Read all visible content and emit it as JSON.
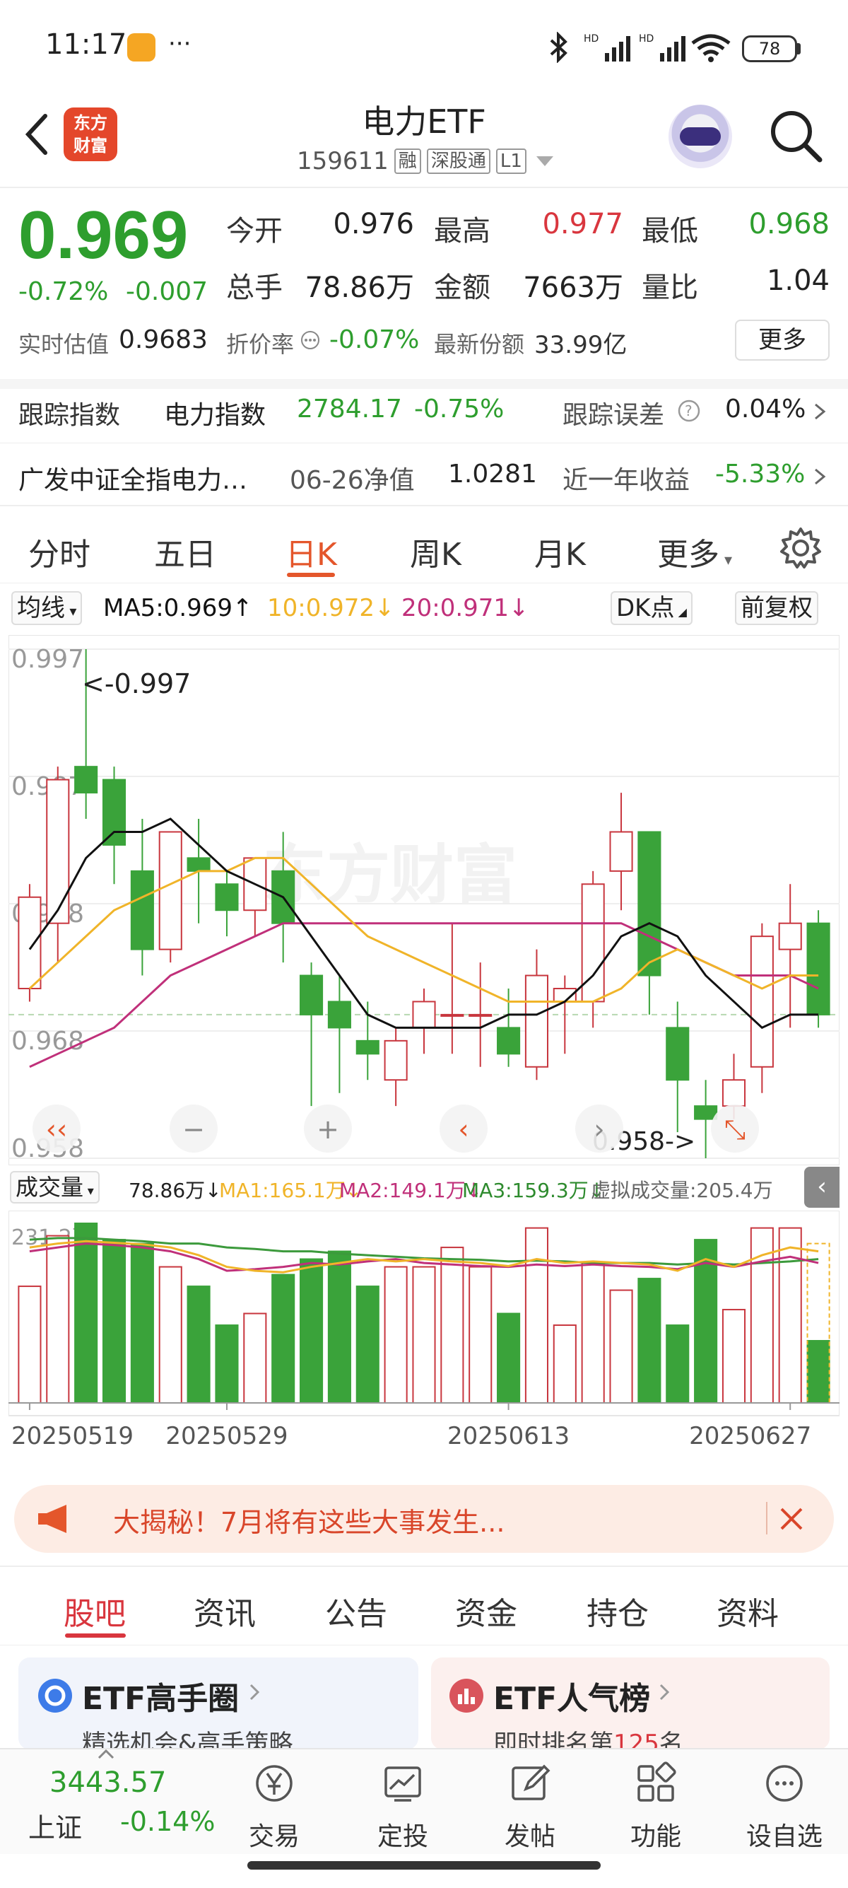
{
  "status_bar": {
    "time": "11:17",
    "dots": "···",
    "battery": "78"
  },
  "header": {
    "title": "电力ETF",
    "code": "159611",
    "tags": [
      "融",
      "深股通",
      "L1"
    ],
    "logo_text": "东方财富"
  },
  "quote": {
    "price": "0.969",
    "change_pct": "-0.72%",
    "change": "-0.007",
    "open_label": "今开",
    "open": "0.976",
    "high_label": "最高",
    "high": "0.977",
    "low_label": "最低",
    "low": "0.968",
    "volume_label": "总手",
    "volume": "78.86万",
    "amount_label": "金额",
    "amount": "7663万",
    "ratio_label": "量比",
    "ratio": "1.04",
    "est_label": "实时估值",
    "est": "0.9683",
    "discount_label": "折价率",
    "discount": "-0.07%",
    "shares_label": "最新份额",
    "shares": "33.99亿",
    "more": "更多"
  },
  "tracking": {
    "label": "跟踪指数",
    "index_name": "电力指数",
    "index_value": "2784.17",
    "index_change": "-0.75%",
    "error_label": "跟踪误差",
    "error_value": "0.04%"
  },
  "fund": {
    "name": "广发中证全指电力…",
    "nav_label": "06-26净值",
    "nav": "1.0281",
    "return_label": "近一年收益",
    "return_value": "-5.33%"
  },
  "kline_tabs": [
    "分时",
    "五日",
    "日K",
    "周K",
    "月K",
    "更多"
  ],
  "chart_toolbar": {
    "ma_select": "均线",
    "ma5": "MA5:0.969↑",
    "ma10": "10:0.972↓",
    "ma20": "20:0.971↓",
    "dk": "DK点",
    "adjust": "前复权",
    "vol_select": "成交量",
    "vol_value": "78.86万↓",
    "vma1": "MA1:165.1万↓",
    "vma2": "MA2:149.1万↓",
    "vma3": "MA3:159.3万↓",
    "virtual_vol": "虚拟成交量:205.4万"
  },
  "chart_data": {
    "type": "candlestick",
    "price_ticks": [
      "0.997",
      "0.987",
      "0.978",
      "0.968",
      "0.958"
    ],
    "ylim": [
      0.958,
      0.997
    ],
    "annotations": {
      "high": "<-0.997",
      "low": "0.958->"
    },
    "watermark": "东方财富",
    "volume_ticks": [
      "231.2万"
    ],
    "x_labels": [
      "20250519",
      "20250529",
      "20250613",
      "20250627"
    ],
    "candles": [
      {
        "o": 0.971,
        "c": 0.978,
        "h": 0.979,
        "l": 0.97,
        "v": 150
      },
      {
        "o": 0.976,
        "c": 0.987,
        "h": 0.988,
        "l": 0.973,
        "v": 215
      },
      {
        "o": 0.988,
        "c": 0.986,
        "h": 0.997,
        "l": 0.984,
        "v": 231
      },
      {
        "o": 0.987,
        "c": 0.982,
        "h": 0.988,
        "l": 0.979,
        "v": 210
      },
      {
        "o": 0.98,
        "c": 0.974,
        "h": 0.984,
        "l": 0.972,
        "v": 205
      },
      {
        "o": 0.974,
        "c": 0.983,
        "h": 0.983,
        "l": 0.973,
        "v": 175
      },
      {
        "o": 0.981,
        "c": 0.98,
        "h": 0.984,
        "l": 0.976,
        "v": 150
      },
      {
        "o": 0.979,
        "c": 0.977,
        "h": 0.98,
        "l": 0.975,
        "v": 100
      },
      {
        "o": 0.977,
        "c": 0.981,
        "h": 0.981,
        "l": 0.975,
        "v": 115
      },
      {
        "o": 0.98,
        "c": 0.976,
        "h": 0.983,
        "l": 0.973,
        "v": 165
      },
      {
        "o": 0.972,
        "c": 0.969,
        "h": 0.973,
        "l": 0.962,
        "v": 185
      },
      {
        "o": 0.97,
        "c": 0.968,
        "h": 0.972,
        "l": 0.963,
        "v": 195
      },
      {
        "o": 0.967,
        "c": 0.966,
        "h": 0.97,
        "l": 0.964,
        "v": 150
      },
      {
        "o": 0.964,
        "c": 0.967,
        "h": 0.968,
        "l": 0.962,
        "v": 175
      },
      {
        "o": 0.968,
        "c": 0.97,
        "h": 0.971,
        "l": 0.966,
        "v": 175
      },
      {
        "o": 0.969,
        "c": 0.969,
        "h": 0.976,
        "l": 0.966,
        "v": 200
      },
      {
        "o": 0.969,
        "c": 0.969,
        "h": 0.973,
        "l": 0.965,
        "v": 175
      },
      {
        "o": 0.968,
        "c": 0.966,
        "h": 0.971,
        "l": 0.965,
        "v": 115
      },
      {
        "o": 0.965,
        "c": 0.972,
        "h": 0.974,
        "l": 0.964,
        "v": 225
      },
      {
        "o": 0.97,
        "c": 0.971,
        "h": 0.972,
        "l": 0.966,
        "v": 100
      },
      {
        "o": 0.97,
        "c": 0.979,
        "h": 0.98,
        "l": 0.968,
        "v": 180
      },
      {
        "o": 0.98,
        "c": 0.983,
        "h": 0.986,
        "l": 0.977,
        "v": 145
      },
      {
        "o": 0.983,
        "c": 0.972,
        "h": 0.983,
        "l": 0.969,
        "v": 160
      },
      {
        "o": 0.968,
        "c": 0.964,
        "h": 0.97,
        "l": 0.96,
        "v": 100
      },
      {
        "o": 0.962,
        "c": 0.961,
        "h": 0.964,
        "l": 0.958,
        "v": 210
      },
      {
        "o": 0.962,
        "c": 0.964,
        "h": 0.966,
        "l": 0.961,
        "v": 120
      },
      {
        "o": 0.965,
        "c": 0.975,
        "h": 0.976,
        "l": 0.963,
        "v": 225
      },
      {
        "o": 0.974,
        "c": 0.976,
        "h": 0.979,
        "l": 0.968,
        "v": 225
      },
      {
        "o": 0.976,
        "c": 0.969,
        "h": 0.977,
        "l": 0.968,
        "v": 80
      }
    ],
    "ma5": [
      0.974,
      0.977,
      0.981,
      0.983,
      0.983,
      0.984,
      0.982,
      0.98,
      0.979,
      0.978,
      0.975,
      0.972,
      0.969,
      0.968,
      0.968,
      0.968,
      0.968,
      0.969,
      0.969,
      0.97,
      0.972,
      0.975,
      0.976,
      0.975,
      0.972,
      0.97,
      0.968,
      0.969,
      0.969
    ],
    "ma10": [
      0.971,
      0.973,
      0.975,
      0.977,
      0.978,
      0.979,
      0.98,
      0.98,
      0.981,
      0.981,
      0.979,
      0.977,
      0.975,
      0.974,
      0.973,
      0.972,
      0.971,
      0.97,
      0.97,
      0.97,
      0.97,
      0.971,
      0.973,
      0.974,
      0.973,
      0.972,
      0.971,
      0.972,
      0.972
    ],
    "ma20": [
      0.965,
      0.966,
      0.967,
      0.968,
      0.97,
      0.972,
      0.973,
      0.974,
      0.975,
      0.976,
      0.976,
      0.976,
      0.976,
      0.976,
      0.976,
      0.976,
      0.976,
      0.976,
      0.976,
      0.976,
      0.976,
      0.976,
      0.975,
      0.974,
      0.973,
      0.972,
      0.972,
      0.972,
      0.971
    ],
    "vma1": [
      200,
      205,
      208,
      206,
      204,
      200,
      190,
      175,
      170,
      168,
      175,
      180,
      185,
      182,
      185,
      182,
      180,
      176,
      185,
      180,
      182,
      180,
      178,
      170,
      185,
      175,
      190,
      200,
      195
    ],
    "vma2": [
      195,
      200,
      205,
      203,
      200,
      195,
      185,
      170,
      172,
      175,
      180,
      178,
      182,
      185,
      180,
      178,
      176,
      175,
      178,
      176,
      178,
      176,
      175,
      172,
      180,
      175,
      182,
      188,
      180
    ],
    "vma3": [
      210,
      212,
      212,
      210,
      208,
      205,
      205,
      200,
      198,
      195,
      195,
      192,
      190,
      188,
      186,
      185,
      184,
      182,
      183,
      182,
      180,
      180,
      180,
      178,
      180,
      178,
      180,
      182,
      185
    ]
  },
  "banner": {
    "text": "大揭秘！7月将有这些大事发生..."
  },
  "content_tabs": [
    "股吧",
    "资讯",
    "公告",
    "资金",
    "持仓",
    "资料"
  ],
  "cards": {
    "left_title": "ETF高手圈",
    "left_sub": "精选机会&高手策略",
    "right_title": "ETF人气榜",
    "right_sub_prefix": "即时排名第",
    "right_sub_num": "125",
    "right_sub_suffix": "名"
  },
  "bottom_nav": {
    "index_value": "3443.57",
    "index_name": "上证",
    "index_change": "-0.14%",
    "items": [
      "交易",
      "定投",
      "发帖",
      "功能",
      "设自选"
    ]
  },
  "colors": {
    "up": "#c8363e",
    "down": "#3aa33a",
    "accent": "#e4562b",
    "ma5": "#111111",
    "ma10": "#f0b429",
    "ma20": "#c0307a"
  }
}
